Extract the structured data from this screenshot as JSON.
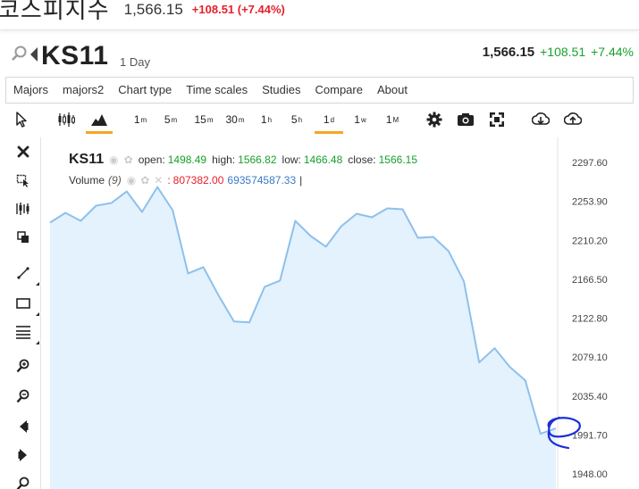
{
  "banner": {
    "name": "코스피지수",
    "price": "1,566.15",
    "change": "+108.51 (+7.44%)"
  },
  "symbol": {
    "ticker": "KS11",
    "period": "1 Day",
    "last": "1,566.15",
    "change": "+108.51",
    "change_pct": "+7.44%"
  },
  "menu": [
    "Majors",
    "majors2",
    "Chart type",
    "Time scales",
    "Studies",
    "Compare",
    "About"
  ],
  "toolbar": {
    "intervals": [
      {
        "base": "1",
        "sup": "m"
      },
      {
        "base": "5",
        "sup": "m"
      },
      {
        "base": "15",
        "sup": "m"
      },
      {
        "base": "30",
        "sup": "m"
      },
      {
        "base": "1",
        "sup": "h"
      },
      {
        "base": "5",
        "sup": "h"
      },
      {
        "base": "1",
        "sup": "d"
      },
      {
        "base": "1",
        "sup": "w"
      },
      {
        "base": "1",
        "sup": "M"
      }
    ],
    "active_interval": "1d"
  },
  "legend": {
    "symbol": "KS11",
    "open_label": "open:",
    "open": "1498.49",
    "high_label": "high:",
    "high": "1566.82",
    "low_label": "low:",
    "low": "1466.48",
    "close_label": "close:",
    "close": "1566.15",
    "volume_label": "Volume",
    "volume_param": "(9)",
    "volume_sep": ":",
    "volume_1": "807382.00",
    "volume_2": "693574587.33",
    "volume_end": "|"
  },
  "colors": {
    "line": "#8ec0ec",
    "fill": "#e3f2fd",
    "up": "#18a02c",
    "down": "#e5202a",
    "accent": "#f5a623",
    "annotation": "#1a2fd8"
  },
  "chart_data": {
    "type": "area",
    "y_ticks": [
      "2297.60",
      "2253.90",
      "2210.20",
      "2166.50",
      "2122.80",
      "2079.10",
      "2035.40",
      "1991.70",
      "1948.00"
    ],
    "ylim": [
      1948.0,
      2297.6
    ],
    "values": [
      2230,
      2241,
      2232,
      2249,
      2252,
      2265,
      2242,
      2270,
      2244,
      2173,
      2180,
      2148,
      2119,
      2118,
      2158,
      2165,
      2232,
      2215,
      2203,
      2226,
      2240,
      2236,
      2246,
      2245,
      2213,
      2214,
      2198,
      2164,
      2073,
      2089,
      2068,
      2053,
      1993,
      1999
    ]
  }
}
